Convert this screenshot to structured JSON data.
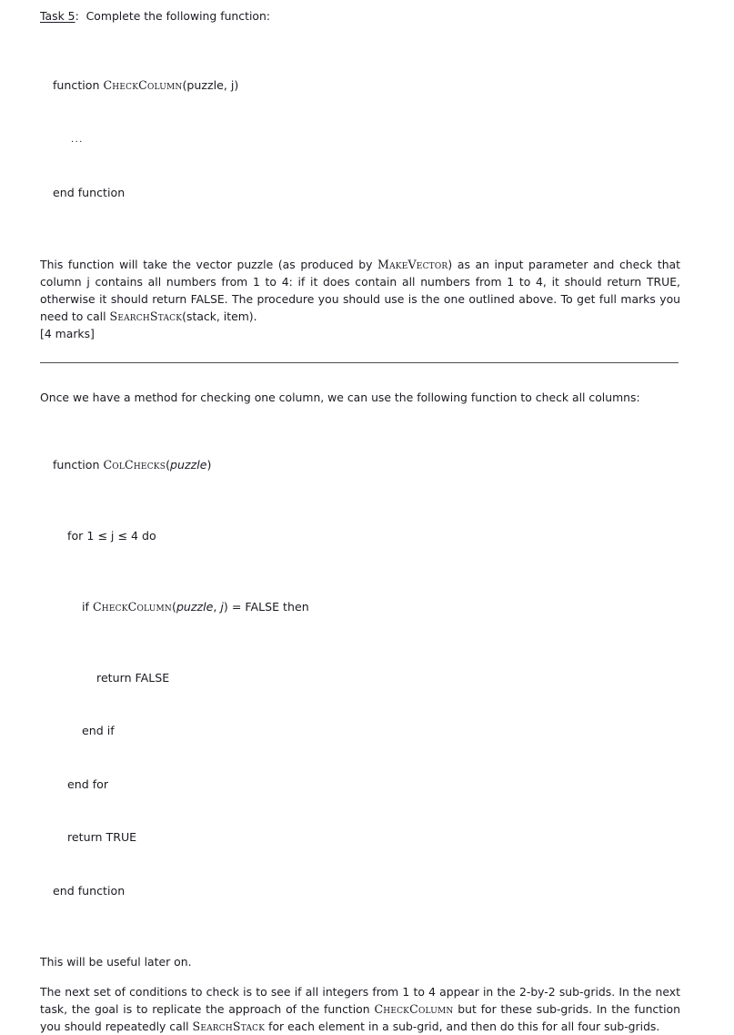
{
  "document": {
    "task": {
      "label": "Task 5",
      "separator": ":",
      "instruction": "Complete the following function:"
    },
    "code_stub": {
      "line_function": "function ",
      "name": "CheckColumn",
      "args": "(puzzle, j)",
      "ellipsis": "...",
      "line_end": "end function"
    },
    "description": {
      "part1": "This function will take the vector puzzle (as produced by ",
      "ref1": "MakeVector",
      "part2": ") as an input parameter and check that column j contains all numbers from 1 to 4: if it does contain all numbers from 1 to 4, it should return TRUE, otherwise it should return FALSE. The procedure you should use is the one outlined above. To get full marks you need to call ",
      "ref2": "SearchStack",
      "part3": "(stack, item)."
    },
    "marks": "[4 marks]",
    "intro_colchecks": "Once we have a method for checking one column, we can use the following function to check all columns:",
    "colchecks": {
      "l1_kw": "function ",
      "l1_name": "ColChecks",
      "l1_open": "(",
      "l1_arg": "puzzle",
      "l1_close": ")",
      "l2": "    for 1 ≤ j ≤ 4 do",
      "l3_pre": "        if ",
      "l3_name": "CheckColumn",
      "l3_open": "(",
      "l3_arg1": "puzzle",
      "l3_comma": ", ",
      "l3_arg2": "j",
      "l3_post": ") = FALSE then",
      "l4": "            return FALSE",
      "l5": "        end if",
      "l6": "    end for",
      "l7": "    return TRUE",
      "l8": "end function"
    },
    "useful_later": "This will be useful later on.",
    "next_conditions": {
      "part1": "The next set of conditions to check is to see if all integers from 1 to 4 appear in the 2-by-2 sub-grids. In the next task, the goal is to replicate the approach of the function ",
      "ref1": "CheckColumn",
      "part2": " but for these sub-grids. In the function you should repeatedly call ",
      "ref2": "SearchStack",
      "part3": " for each element in a sub-grid, and then do this for all four sub-grids."
    }
  }
}
